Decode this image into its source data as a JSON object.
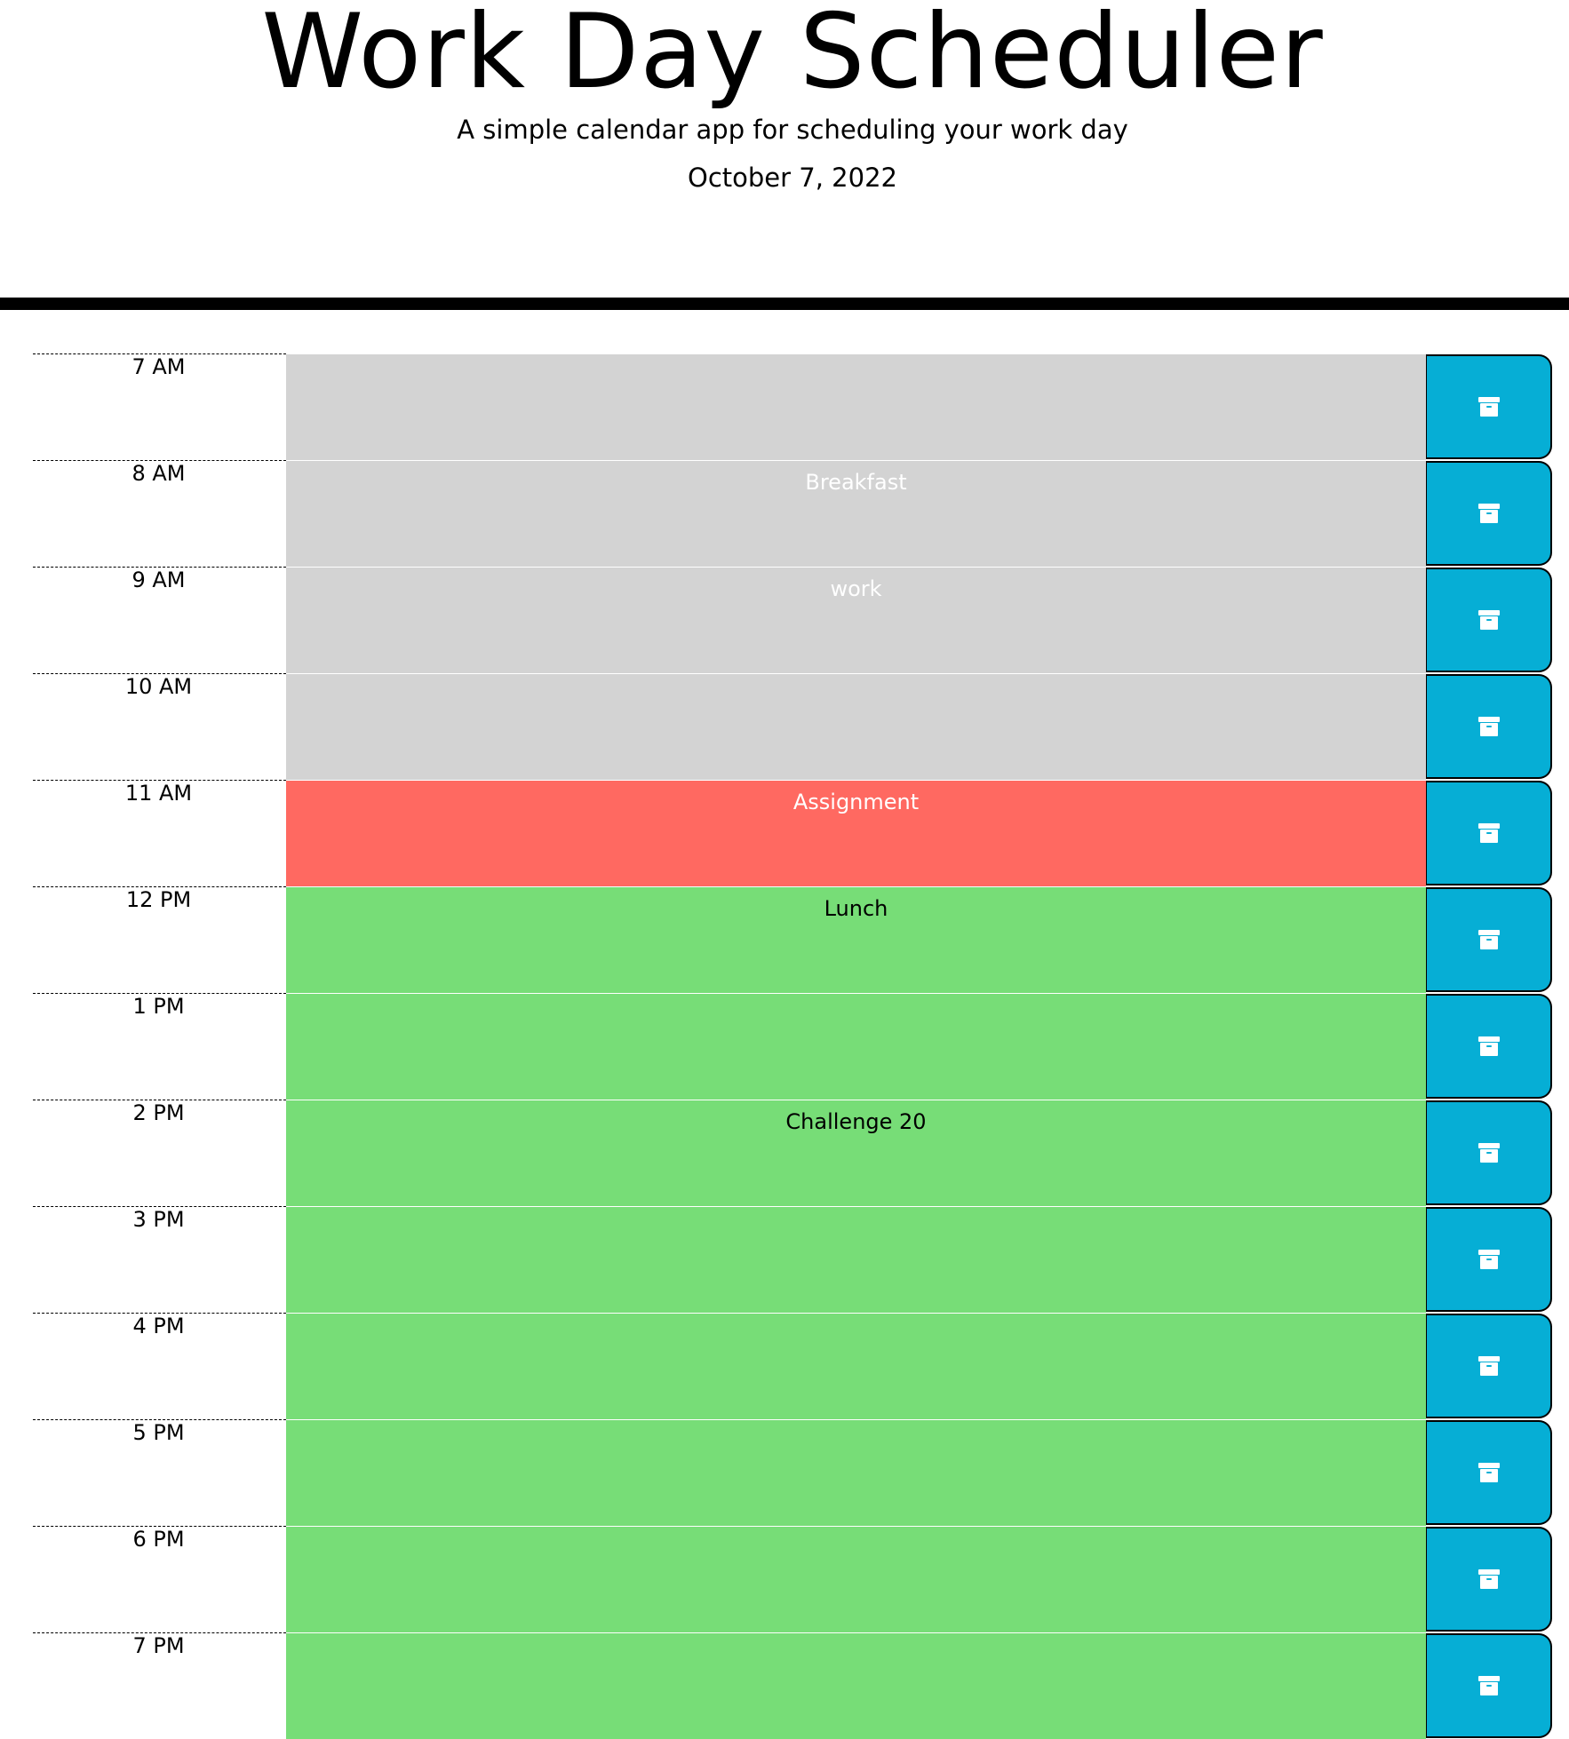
{
  "header": {
    "title": "Work Day Scheduler",
    "subtitle": "A simple calendar app for scheduling your work day",
    "current_date": "October 7, 2022"
  },
  "colors": {
    "past": "#d3d3d3",
    "present": "#ff6961",
    "future": "#77dd77",
    "save_button": "#06aed5"
  },
  "time_blocks": [
    {
      "hour": "7 AM",
      "text": "",
      "state": "past"
    },
    {
      "hour": "8 AM",
      "text": "Breakfast",
      "state": "past"
    },
    {
      "hour": "9 AM",
      "text": "work",
      "state": "past"
    },
    {
      "hour": "10 AM",
      "text": "",
      "state": "past"
    },
    {
      "hour": "11 AM",
      "text": "Assignment",
      "state": "present"
    },
    {
      "hour": "12 PM",
      "text": "Lunch",
      "state": "future"
    },
    {
      "hour": "1 PM",
      "text": "",
      "state": "future"
    },
    {
      "hour": "2 PM",
      "text": "Challenge 20",
      "state": "future"
    },
    {
      "hour": "3 PM",
      "text": "",
      "state": "future"
    },
    {
      "hour": "4 PM",
      "text": "",
      "state": "future"
    },
    {
      "hour": "5 PM",
      "text": "",
      "state": "future"
    },
    {
      "hour": "6 PM",
      "text": "",
      "state": "future"
    },
    {
      "hour": "7 PM",
      "text": "",
      "state": "future"
    }
  ],
  "save_icon": "archive-icon"
}
